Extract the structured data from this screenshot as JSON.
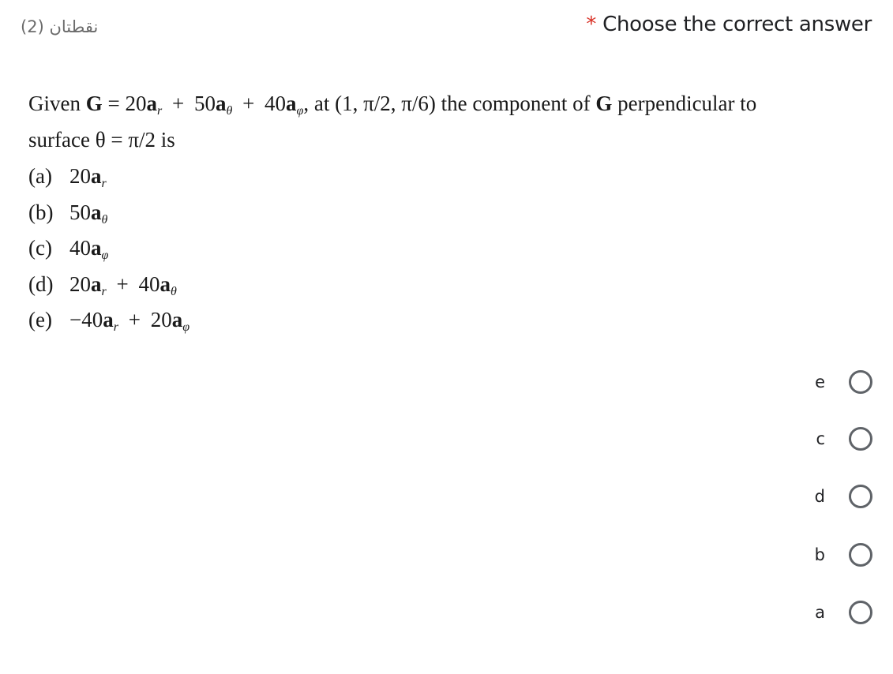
{
  "header": {
    "points": "نقطتان (2)",
    "required_marker": "*",
    "title": "Choose the correct answer"
  },
  "question": {
    "line1_a": "Given ",
    "line1_G": "G",
    "line1_eq": " = 20",
    "a_vec": "a",
    "sub_r": "r",
    "sub_theta": "θ",
    "sub_phi": "φ",
    "plus": "+",
    "c50": "50",
    "c40": "40",
    "line1_mid": ", at (1, π/2, π/6) the component of ",
    "line1_end": " perpendicular to",
    "line2": "surface θ = π/2 is"
  },
  "options": [
    {
      "label": "(a)",
      "text": "20a_r"
    },
    {
      "label": "(b)",
      "text": "50a_θ"
    },
    {
      "label": "(c)",
      "text": "40a_φ"
    },
    {
      "label": "(d)",
      "text": "20a_r + 40a_θ"
    },
    {
      "label": "(e)",
      "text": "−40a_r + 20a_φ"
    }
  ],
  "opt_parts": {
    "n20": "20",
    "n50": "50",
    "n40": "40",
    "neg40": "−40"
  },
  "choices": [
    {
      "label": "e",
      "selected": false
    },
    {
      "label": "c",
      "selected": false
    },
    {
      "label": "d",
      "selected": false
    },
    {
      "label": "b",
      "selected": false
    },
    {
      "label": "a",
      "selected": false
    }
  ]
}
